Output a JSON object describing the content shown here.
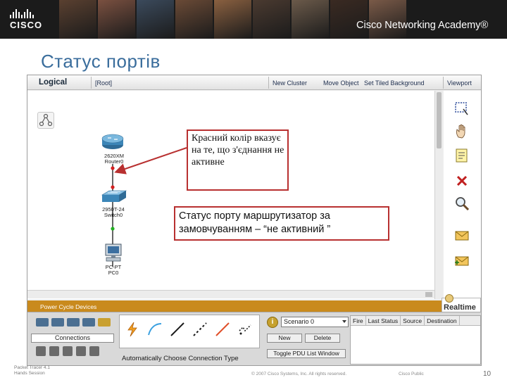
{
  "banner": {
    "logo_text": "CISCO",
    "academy_text": "Cisco Networking Academy®",
    "photos": [
      "#5a4030",
      "#7a5040",
      "#3b4a5c",
      "#6a4a36",
      "#8a6040",
      "#4a3a30",
      "#6b5a4a",
      "#3a2a22",
      "#7a5a48"
    ]
  },
  "slide": {
    "title": "Статус портів",
    "page_number": "10"
  },
  "pt": {
    "toolbar": {
      "logical": "Logical",
      "root": "[Root]",
      "new_cluster": "New Cluster",
      "move_object": "Move Object",
      "set_bg": "Set Tiled Background",
      "viewport": "Viewport"
    },
    "devices": {
      "router_model": "2620XM",
      "router_name": "Router0",
      "switch_model": "2950T-24",
      "switch_name": "Switch0",
      "pc_model": "PC-PT",
      "pc_name": "PC0"
    },
    "power_cycle": "Power Cycle Devices",
    "realtime": "Realtime",
    "connections_label": "Connections",
    "cable_type": "Automatically Choose Connection Type",
    "scenario": "Scenario 0",
    "new_btn": "New",
    "delete_btn": "Delete",
    "toggle_pdu": "Toggle PDU List Window",
    "pdu_columns": [
      "Fire",
      "Last Status",
      "Source",
      "Destination"
    ],
    "info_icon": "i",
    "colors": {
      "link_down": "#d42020",
      "link_up": "#22b022",
      "panel_orange": "#c98a1d"
    }
  },
  "callouts": {
    "red_text": "Красний колір вказує на те, що з'єднання не активне",
    "port_text": "Статус порту маршрутизатор за замовчуванням – “не активний ”"
  },
  "footer": {
    "left_line1": "Packet Tracer 4.1",
    "left_line2": "Hands Session",
    "copyright": "© 2007 Cisco Systems, Inc. All rights reserved.",
    "public": "Cisco Public"
  }
}
